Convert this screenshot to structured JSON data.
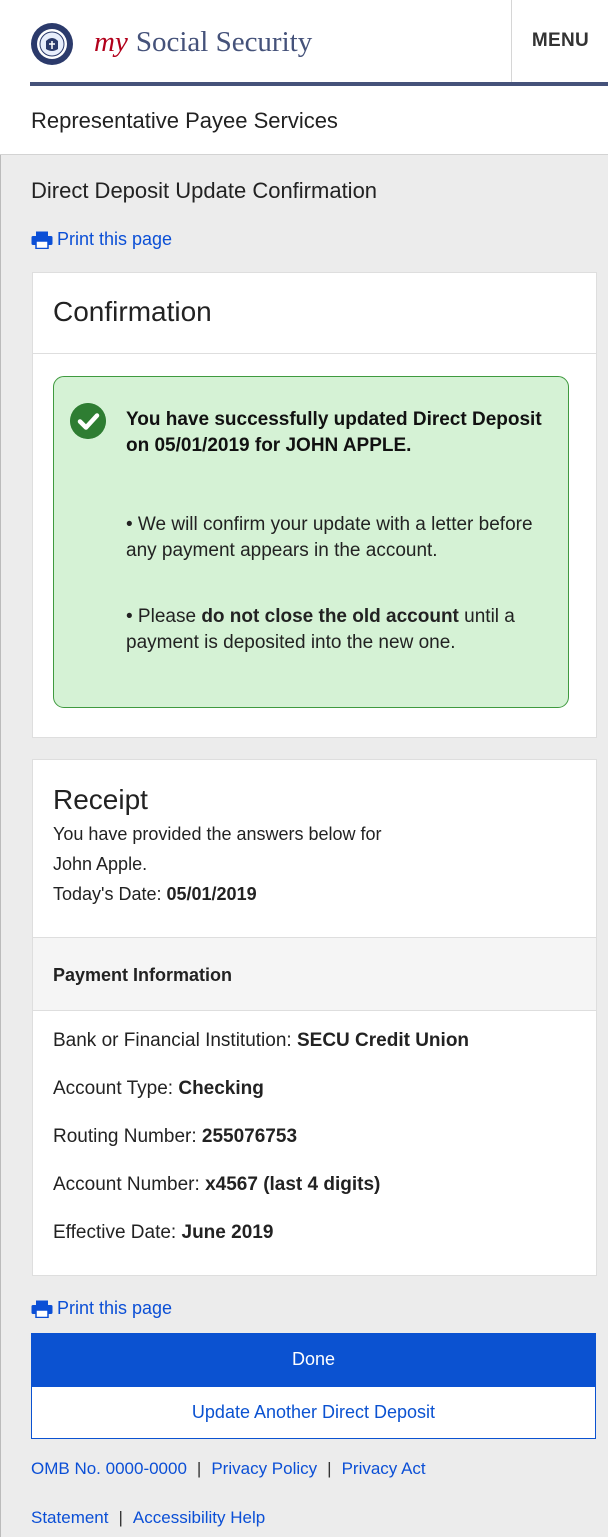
{
  "header": {
    "brand_my": "my",
    "brand_rest": "Social Security",
    "menu_label": "MENU",
    "subtitle": "Representative Payee Services"
  },
  "page": {
    "title": "Direct Deposit Update Confirmation",
    "print_label": "Print this page"
  },
  "confirmation": {
    "heading": "Confirmation",
    "alert_title": "You have successfully updated Direct Deposit on 05/01/2019 for JOHN APPLE.",
    "bullet1": "• We will confirm your update with a letter before any payment appears in the account.",
    "bullet2_pre": "• Please ",
    "bullet2_bold": "do not close the old account",
    "bullet2_post": " until a payment is deposited into the new one."
  },
  "receipt": {
    "heading": "Receipt",
    "line1": "You have provided the answers below for",
    "line2": "John Apple.",
    "date_label": "Today's Date: ",
    "date_value": "05/01/2019",
    "payment_heading": "Payment Information",
    "rows": [
      {
        "label": "Bank or Financial Institution: ",
        "value": "SECU Credit Union"
      },
      {
        "label": "Account Type: ",
        "value": "Checking"
      },
      {
        "label": "Routing Number: ",
        "value": "255076753"
      },
      {
        "label": "Account Number: ",
        "value": "x4567 (last 4 digits)"
      },
      {
        "label": "Effective Date: ",
        "value": "June 2019"
      }
    ]
  },
  "actions": {
    "done_label": "Done",
    "update_label": "Update Another Direct Deposit"
  },
  "footer": {
    "omb": "OMB No. 0000-0000",
    "privacy_policy": "Privacy Policy",
    "privacy_act": "Privacy Act",
    "statement": "Statement",
    "accessibility": "Accessibility Help",
    "separator": "|"
  },
  "colors": {
    "accent_blue": "#0b52d1",
    "brand_navy": "#45527a",
    "brand_red": "#b2001b",
    "success_bg": "#d5f2d5",
    "success_border": "#3f9a3f"
  },
  "icons": {
    "logo": "ssa-seal-icon",
    "print": "printer-icon",
    "success": "check-circle-icon"
  }
}
